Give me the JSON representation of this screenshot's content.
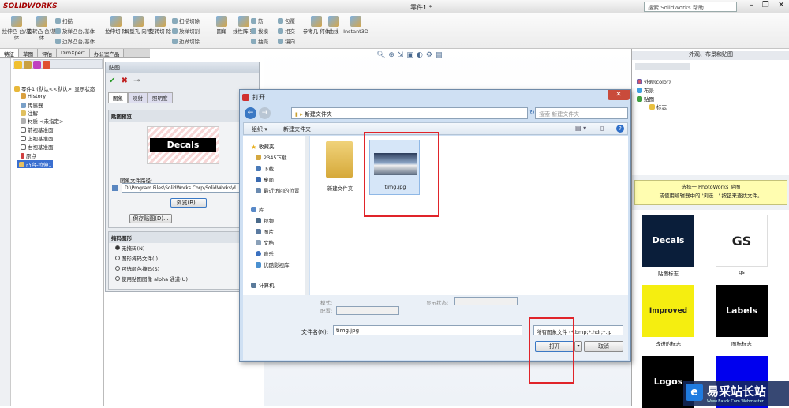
{
  "app": {
    "name": "SOLIDWORKS",
    "doc_title": "零件1 *",
    "help_search": "搜索 SolidWorks 帮助"
  },
  "ribbon": {
    "big": [
      "拉伸凸\n台/基体",
      "旋转凸\n台/基体",
      "拉伸切\n除",
      "异型孔\n向导",
      "旋转切\n除",
      "圆角",
      "线性阵\n列",
      "参考几\n何体",
      "曲线",
      "Instant3D"
    ],
    "small": [
      "扫描",
      "放样凸台/基体",
      "边界凸台/基体",
      "扫描切除",
      "放样切割",
      "边界切除",
      "筋",
      "拔模",
      "抽壳",
      "包覆",
      "相交",
      "镜向"
    ]
  },
  "feature_tabs": [
    "特征",
    "草图",
    "评估",
    "DimXpert",
    "办公室产品"
  ],
  "tree": {
    "root": "零件1 (默认<<默认>_显示状态",
    "items": [
      "History",
      "传感器",
      "注解",
      "材质 <未指定>",
      "前视基准面",
      "上视基准面",
      "右视基准面",
      "原点",
      "凸台-拉伸1"
    ]
  },
  "pm": {
    "title": "贴图",
    "tabs": [
      "图象",
      "映射",
      "照明度"
    ],
    "preview_group": "贴图预览",
    "decal_text": "Decals",
    "path_label": "图象文件路径:",
    "path_value": "D:\\Program Files\\SolidWorks Corp\\SolidWorks\\d",
    "browse": "浏览(B)...",
    "save_image": "保存贴图(D)...",
    "mask_group": "掩码图形",
    "mask_options": [
      "无掩码(N)",
      "图形掩码文件(I)",
      "可选颜色掩码(S)",
      "使用贴图图像 alpha 通道(U)"
    ]
  },
  "dialog": {
    "title": "打开",
    "address": "新建文件夹",
    "search_placeholder": "搜索 新建文件夹",
    "organize": "组织 ▾",
    "new_folder": "新建文件夹",
    "nav_fav": "收藏夹",
    "nav_items": [
      "2345下载",
      "下载",
      "桌面",
      "最近访问的位置"
    ],
    "nav_lib": "库",
    "nav_lib_items": [
      "视频",
      "图片",
      "文档",
      "音乐",
      "优酷影视库"
    ],
    "nav_pc": "计算机",
    "files": [
      {
        "name": "新建文件夹"
      },
      {
        "name": "timg.jpg"
      }
    ],
    "mode_label": "模式:",
    "config_label": "配置:",
    "display_state_label": "显示状态:",
    "filename_label": "文件名(N):",
    "filename_value": "timg.jpg",
    "filetype_value": "所有图象文件 (*.bmp;*.hdr;*.jp",
    "open_button": "打开",
    "cancel_button": "取消"
  },
  "taskpane": {
    "title": "外观、布景和贴图",
    "tree": [
      "外观(color)",
      "布景",
      "贴图",
      "标志"
    ],
    "message_line1": "选择一 PhotoWorks 贴图",
    "message_line2": "或使用编辑器中的 '浏选...' 按钮来查找文件。",
    "thumbs": [
      {
        "label": "贴图标志",
        "text": "Decals"
      },
      {
        "label": "gs",
        "text": "GS"
      },
      {
        "label": "改进的标志",
        "text": "Improved"
      },
      {
        "label": "图标标志",
        "text": "Labels"
      },
      {
        "label": "",
        "text": "Logos"
      },
      {
        "label": "",
        "text": ""
      }
    ]
  },
  "watermark": {
    "text": "易采站长站",
    "sub": "Www.Easck.Com Webmaster"
  },
  "colors": {
    "highlight_red": "#e0242a",
    "message_yellow": "#fffdb0"
  }
}
